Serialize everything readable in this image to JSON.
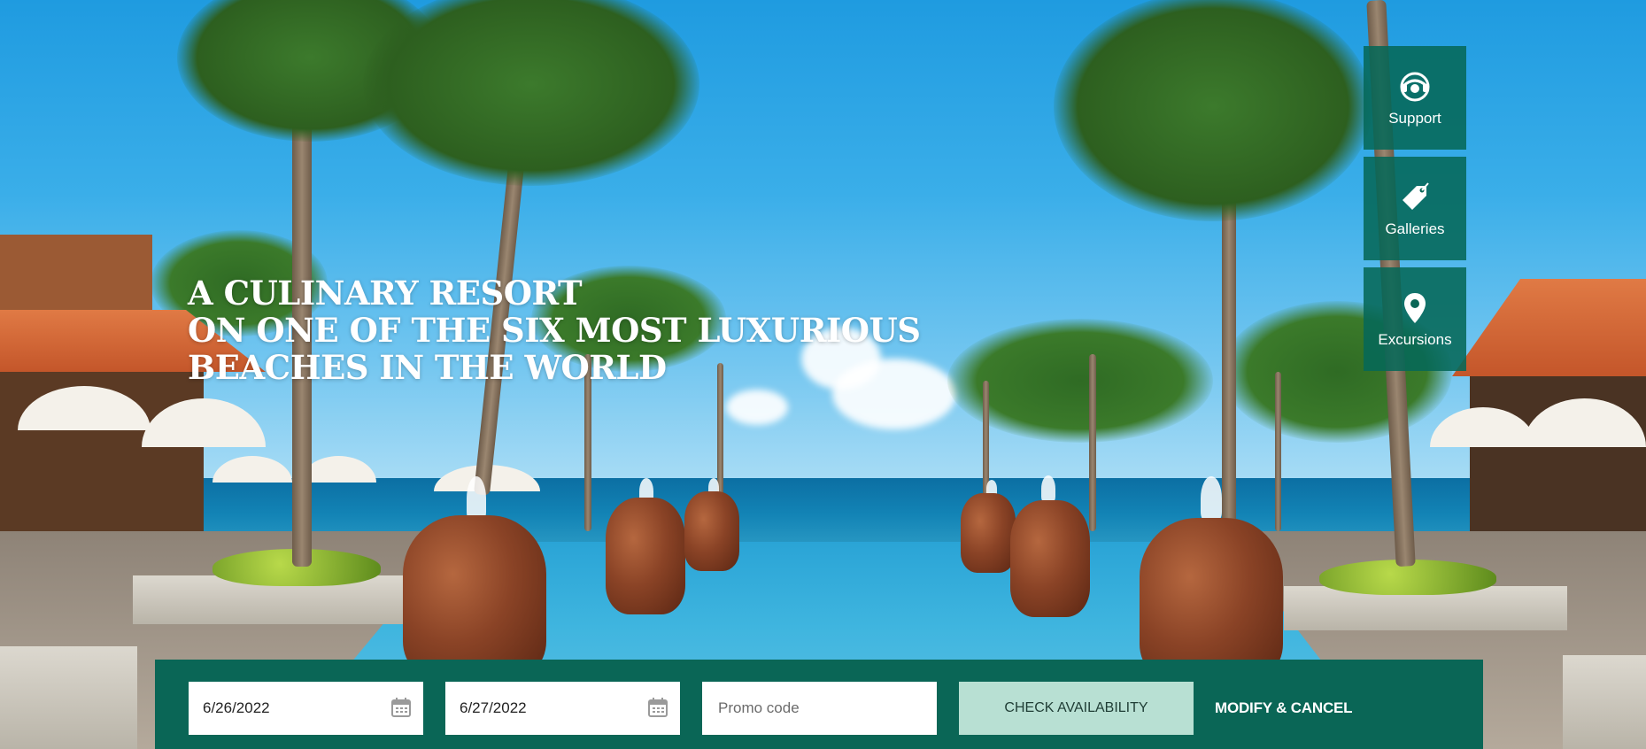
{
  "hero": {
    "headline": [
      "A CULINARY RESORT",
      "ON ONE OF THE SIX MOST LUXURIOUS",
      "BEACHES IN THE WORLD"
    ]
  },
  "side_menu": {
    "items": [
      {
        "label": "Support",
        "icon": "support-icon"
      },
      {
        "label": "Galleries",
        "icon": "tag-icon"
      },
      {
        "label": "Excursions",
        "icon": "map-pin-icon"
      }
    ]
  },
  "booking": {
    "check_in": "6/26/2022",
    "check_out": "6/27/2022",
    "promo_placeholder": "Promo code",
    "check_button": "CHECK AVAILABILITY",
    "modify_link": "MODIFY & CANCEL"
  },
  "colors": {
    "brand_green": "#0a6656",
    "button_mint": "#b8e0d3"
  }
}
